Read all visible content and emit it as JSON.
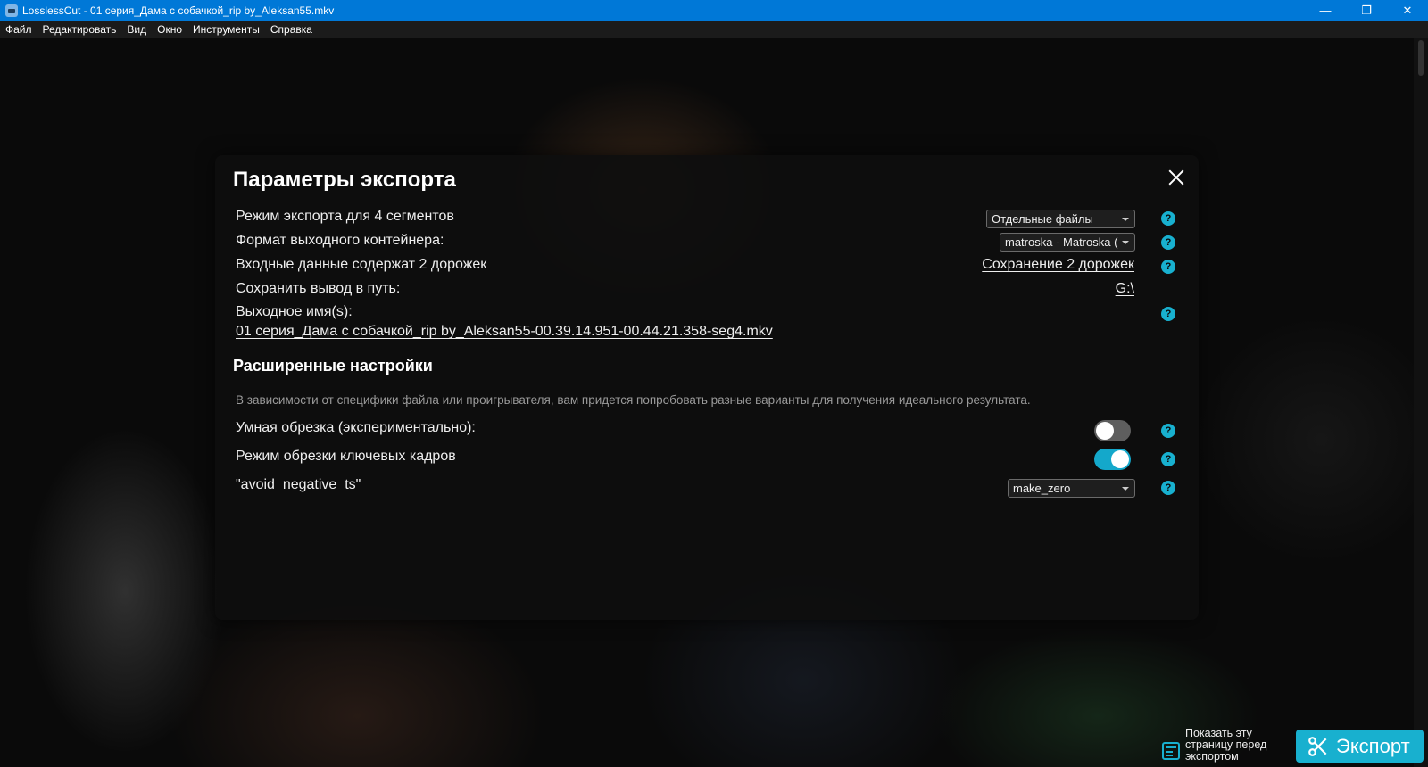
{
  "window": {
    "title": "LosslessCut - 01 серия_Дама с собачкой_rip by_Aleksan55.mkv",
    "minimize": "—",
    "maximize": "❐",
    "close": "✕"
  },
  "menu": [
    "Файл",
    "Редактировать",
    "Вид",
    "Окно",
    "Инструменты",
    "Справка"
  ],
  "dialog": {
    "title": "Параметры экспорта",
    "rows": {
      "export_mode_label": "Режим экспорта для 4 сегментов",
      "export_mode_value": "Отдельные файлы",
      "container_label": "Формат выходного контейнера:",
      "container_value": "matroska - Matroska (",
      "tracks_label": "Входные данные содержат 2 дорожек",
      "tracks_value": "Сохранение 2 дорожек",
      "save_path_label": "Сохранить вывод в путь:",
      "save_path_value": "G:\\",
      "output_name_label": "Выходное имя(s):",
      "output_name_value": "01 серия_Дама с собачкой_rip by_Aleksan55-00.39.14.951-00.44.21.358-seg4.mkv"
    },
    "advanced": {
      "title": "Расширенные настройки",
      "note": "В зависимости от специфики файла или проигрывателя, вам придется попробовать разные варианты для получения идеального результата.",
      "smart_cut_label": "Умная обрезка (экспериментально):",
      "smart_cut_enabled": false,
      "keyframe_cut_label": "Режим обрезки ключевых кадров",
      "keyframe_cut_enabled": true,
      "avoid_negative_ts_label": "\"avoid_negative_ts\"",
      "avoid_negative_ts_value": "make_zero"
    },
    "help_glyph": "?"
  },
  "footer": {
    "show_page_label": "Показать эту страницу перед экспортом",
    "export_label": "Экспорт"
  },
  "colors": {
    "accent": "#18b0cf",
    "titlebar": "#0078d7"
  }
}
